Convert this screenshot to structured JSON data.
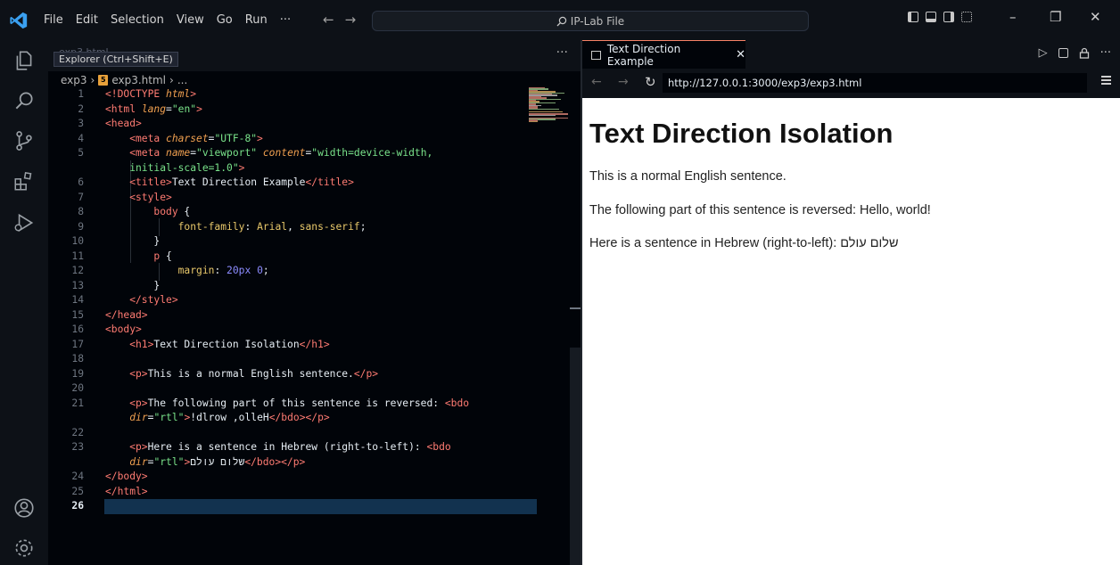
{
  "titlebar": {
    "menu": [
      "File",
      "Edit",
      "Selection",
      "View",
      "Go",
      "Run",
      "···"
    ],
    "search": "IP-Lab File"
  },
  "editor": {
    "ghost_tab": "exp3.html",
    "tooltip": "Explorer (Ctrl+Shift+E)",
    "tab_more": "···",
    "breadcrumb": {
      "folder": "exp3",
      "file": "exp3.html",
      "rest": "..."
    }
  },
  "browser": {
    "tab_title": "Text Direction Example",
    "url": "http://127.0.0.1:3000/exp3/exp3.html",
    "page": {
      "heading": "Text Direction Isolation",
      "p1": "This is a normal English sentence.",
      "p2": "The following part of this sentence is reversed: Hello, world!",
      "p3": "Here is a sentence in Hebrew (right-to-left): שלום עולם"
    }
  },
  "code_lines": [
    [
      {
        "t": "<!DOCTYPE ",
        "c": "tag"
      },
      {
        "t": "html",
        "c": "attr"
      },
      {
        "t": ">",
        "c": "tag"
      }
    ],
    [
      {
        "t": "<html ",
        "c": "tag"
      },
      {
        "t": "lang",
        "c": "attr"
      },
      {
        "t": "=",
        "c": ""
      },
      {
        "t": "\"en\"",
        "c": "str"
      },
      {
        "t": ">",
        "c": "tag"
      }
    ],
    [
      {
        "t": "<head>",
        "c": "tag"
      }
    ],
    [
      {
        "t": "    <meta ",
        "c": "tag"
      },
      {
        "t": "charset",
        "c": "attr"
      },
      {
        "t": "=",
        "c": ""
      },
      {
        "t": "\"UTF-8\"",
        "c": "str"
      },
      {
        "t": ">",
        "c": "tag"
      }
    ],
    [
      {
        "t": "    <meta ",
        "c": "tag"
      },
      {
        "t": "name",
        "c": "attr"
      },
      {
        "t": "=",
        "c": ""
      },
      {
        "t": "\"viewport\" ",
        "c": "str"
      },
      {
        "t": "content",
        "c": "attr"
      },
      {
        "t": "=",
        "c": ""
      },
      {
        "t": "\"width=device-width,",
        "c": "str"
      }
    ],
    [
      {
        "t": "    initial-scale=1.0\"",
        "c": "str"
      },
      {
        "t": ">",
        "c": "tag"
      }
    ],
    [
      {
        "t": "    <title>",
        "c": "tag"
      },
      {
        "t": "Text Direction Example",
        "c": ""
      },
      {
        "t": "</title>",
        "c": "tag"
      }
    ],
    [
      {
        "t": "    <style>",
        "c": "tag"
      }
    ],
    [
      {
        "t": "        body",
        "c": "sel"
      },
      {
        "t": " {",
        "c": ""
      }
    ],
    [
      {
        "t": "            ",
        "c": ""
      },
      {
        "t": "font-family",
        "c": "prop"
      },
      {
        "t": ": ",
        "c": ""
      },
      {
        "t": "Arial",
        "c": "prop"
      },
      {
        "t": ", ",
        "c": ""
      },
      {
        "t": "sans-serif",
        "c": "prop"
      },
      {
        "t": ";",
        "c": ""
      }
    ],
    [
      {
        "t": "        }",
        "c": ""
      }
    ],
    [
      {
        "t": "        p",
        "c": "sel"
      },
      {
        "t": " {",
        "c": ""
      }
    ],
    [
      {
        "t": "            ",
        "c": ""
      },
      {
        "t": "margin",
        "c": "prop"
      },
      {
        "t": ": ",
        "c": ""
      },
      {
        "t": "20px",
        "c": "num"
      },
      {
        "t": " ",
        "c": ""
      },
      {
        "t": "0",
        "c": "num"
      },
      {
        "t": ";",
        "c": ""
      }
    ],
    [
      {
        "t": "        }",
        "c": ""
      }
    ],
    [
      {
        "t": "    </style>",
        "c": "tag"
      }
    ],
    [
      {
        "t": "</head>",
        "c": "tag"
      }
    ],
    [
      {
        "t": "<body>",
        "c": "tag"
      }
    ],
    [
      {
        "t": "    <h1>",
        "c": "tag"
      },
      {
        "t": "Text Direction Isolation",
        "c": ""
      },
      {
        "t": "</h1>",
        "c": "tag"
      }
    ],
    [
      {
        "t": "",
        "c": ""
      }
    ],
    [
      {
        "t": "    <p>",
        "c": "tag"
      },
      {
        "t": "This is a normal English sentence.",
        "c": ""
      },
      {
        "t": "</p>",
        "c": "tag"
      }
    ],
    [
      {
        "t": "",
        "c": ""
      }
    ],
    [
      {
        "t": "    <p>",
        "c": "tag"
      },
      {
        "t": "The following part of this sentence is reversed: ",
        "c": ""
      },
      {
        "t": "<bdo",
        "c": "tag"
      }
    ],
    [
      {
        "t": "    ",
        "c": ""
      },
      {
        "t": "dir",
        "c": "attr"
      },
      {
        "t": "=",
        "c": ""
      },
      {
        "t": "\"rtl\"",
        "c": "str"
      },
      {
        "t": ">",
        "c": "tag"
      },
      {
        "t": "!dlrow ,olleH",
        "c": ""
      },
      {
        "t": "</bdo></p>",
        "c": "tag"
      }
    ],
    [
      {
        "t": "",
        "c": ""
      }
    ],
    [
      {
        "t": "    <p>",
        "c": "tag"
      },
      {
        "t": "Here is a sentence in Hebrew (right-to-left): ",
        "c": ""
      },
      {
        "t": "<bdo",
        "c": "tag"
      }
    ],
    [
      {
        "t": "    ",
        "c": ""
      },
      {
        "t": "dir",
        "c": "attr"
      },
      {
        "t": "=",
        "c": ""
      },
      {
        "t": "\"rtl\"",
        "c": "str"
      },
      {
        "t": ">",
        "c": "tag"
      },
      {
        "t": "שלום עולם",
        "c": ""
      },
      {
        "t": "</bdo></p>",
        "c": "tag"
      }
    ],
    [
      {
        "t": "</body>",
        "c": "tag"
      }
    ],
    [
      {
        "t": "</html>",
        "c": "tag"
      }
    ],
    [
      {
        "t": "",
        "c": ""
      }
    ]
  ],
  "line_numbers": [
    "1",
    "2",
    "3",
    "4",
    "5",
    "",
    "6",
    "7",
    "8",
    "9",
    "10",
    "11",
    "12",
    "13",
    "14",
    "15",
    "16",
    "17",
    "18",
    "19",
    "20",
    "21",
    "",
    "22",
    "23",
    "",
    "24",
    "25",
    "26"
  ]
}
